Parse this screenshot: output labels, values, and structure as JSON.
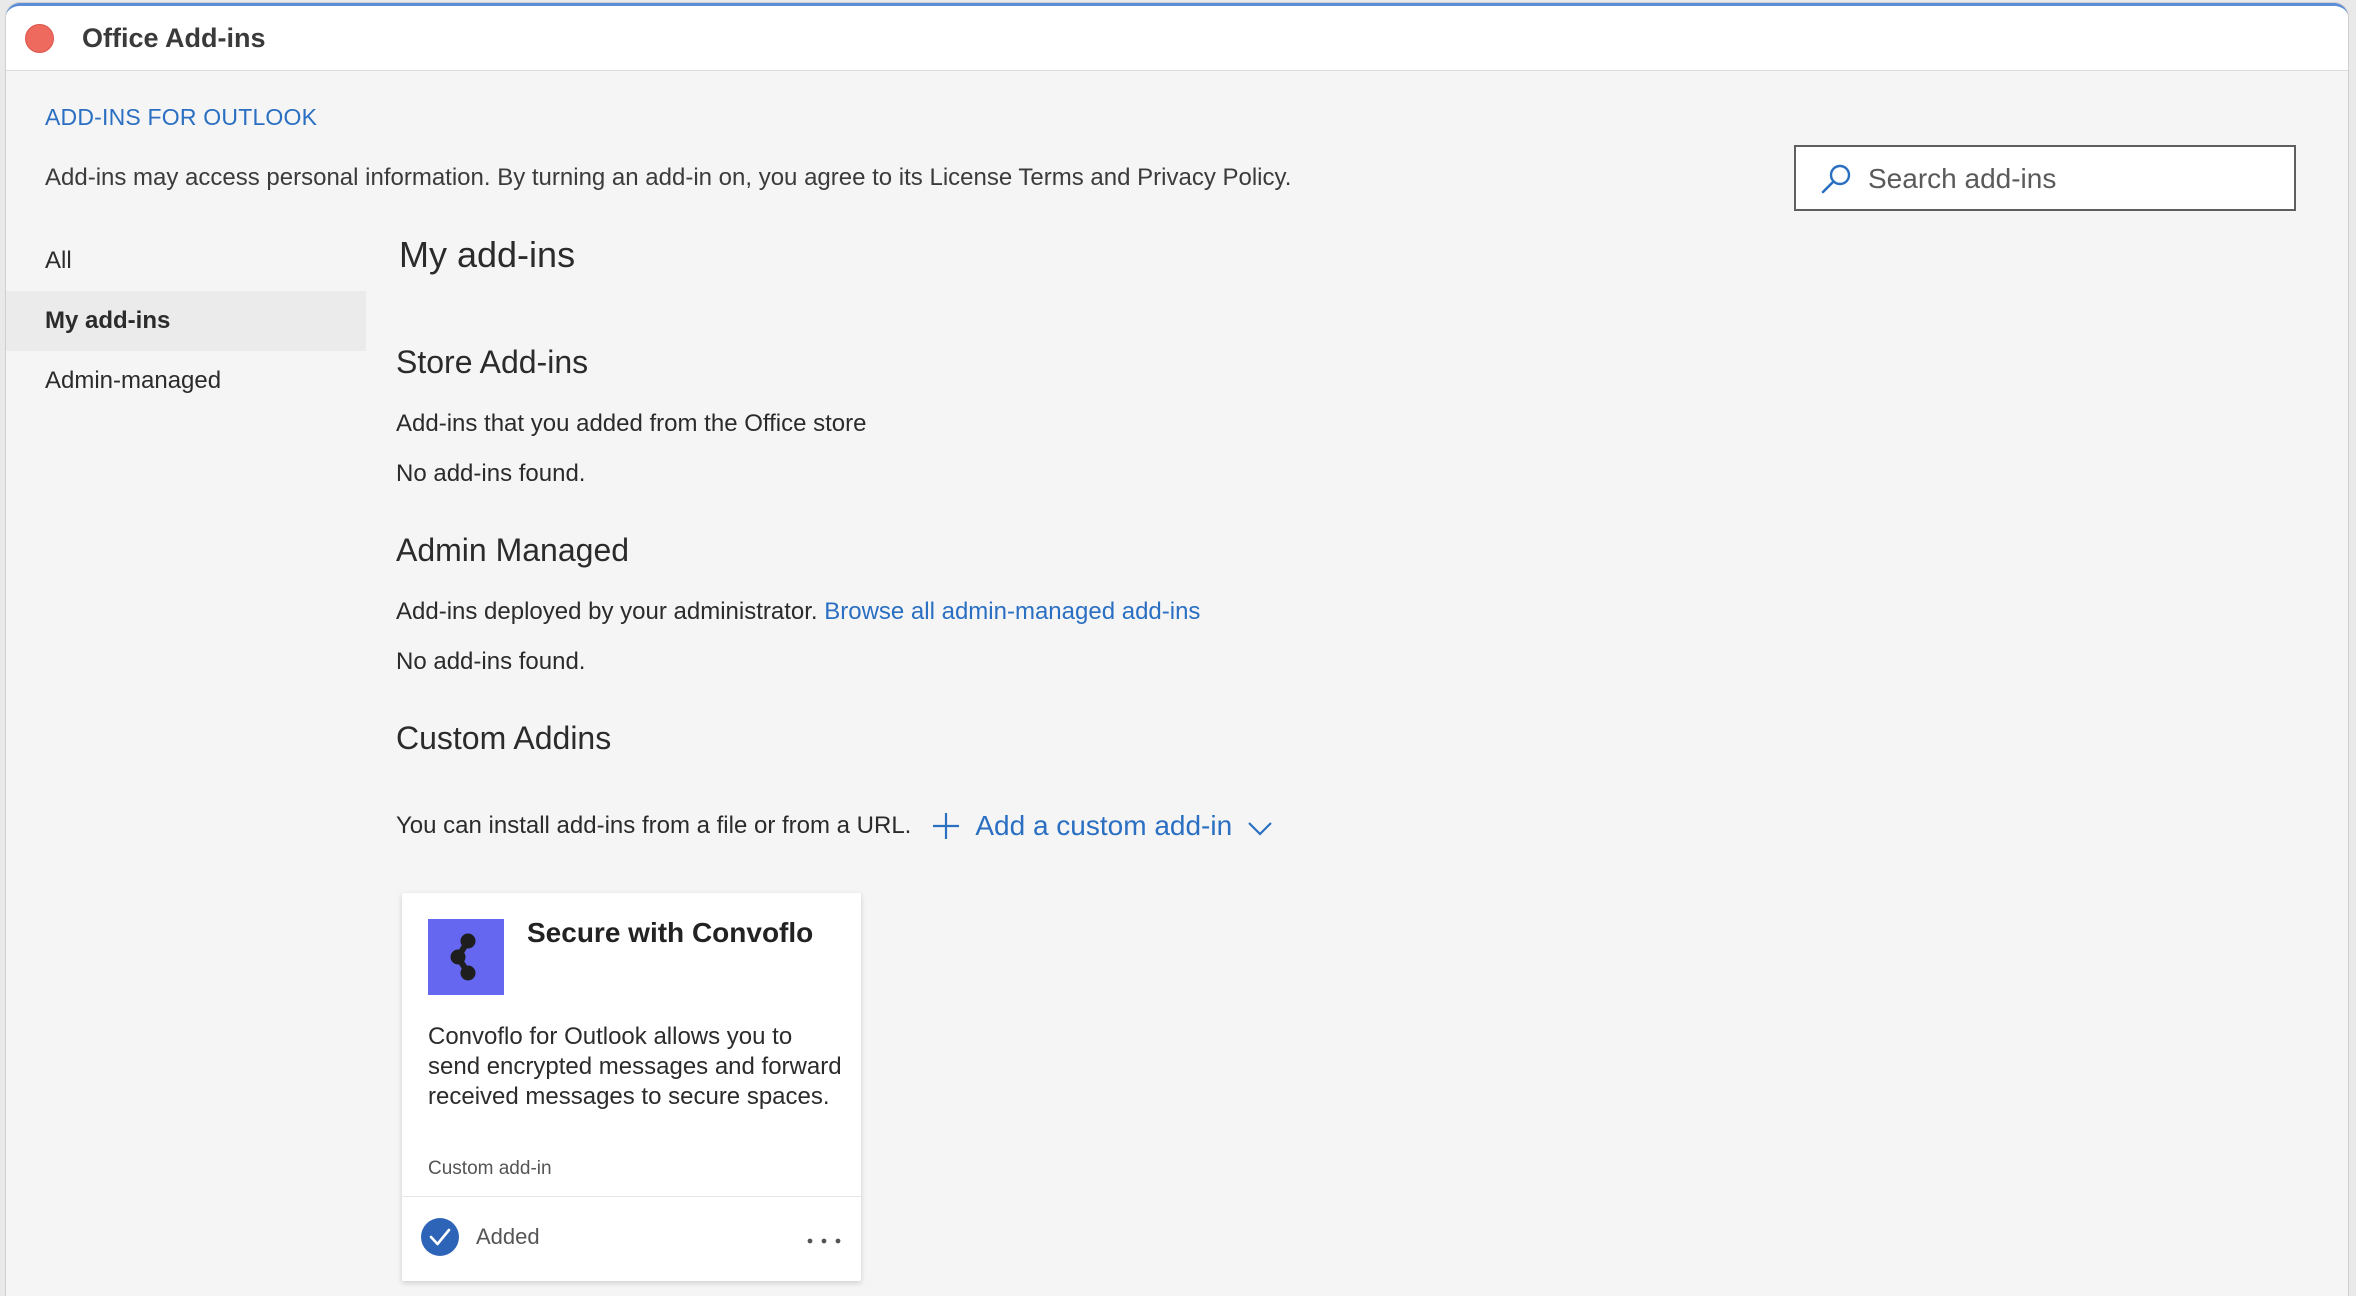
{
  "window": {
    "title": "Office Add-ins"
  },
  "header": {
    "link": "ADD-INS FOR OUTLOOK",
    "disclaimer": "Add-ins may access personal information. By turning an add-in on, you agree to its License Terms and Privacy Policy."
  },
  "search": {
    "placeholder": "Search add-ins",
    "icon": "search-icon"
  },
  "sidebar": {
    "items": [
      {
        "label": "All",
        "selected": false
      },
      {
        "label": "My add-ins",
        "selected": true
      },
      {
        "label": "Admin-managed",
        "selected": false
      }
    ]
  },
  "main": {
    "title": "My add-ins",
    "store": {
      "heading": "Store Add-ins",
      "description": "Add-ins that you added from the Office store",
      "empty": "No add-ins found."
    },
    "admin": {
      "heading": "Admin Managed",
      "description": "Add-ins deployed by your administrator.",
      "link": "Browse all admin-managed add-ins",
      "empty": "No add-ins found."
    },
    "custom": {
      "heading": "Custom Addins",
      "description": "You can install add-ins from a file or from a URL.",
      "add_label": "Add a custom add-in"
    },
    "card": {
      "title": "Secure with Convoflo",
      "description": "Convoflo for Outlook allows you to send encrypted messages and forward received messages to secure spaces.",
      "type": "Custom add-in",
      "status": "Added",
      "more": "..."
    }
  },
  "colors": {
    "accent": "#2a6fc2",
    "logo_bg": "#6567f0",
    "close": "#ee6a5f",
    "status_check": "#2e64b8"
  }
}
